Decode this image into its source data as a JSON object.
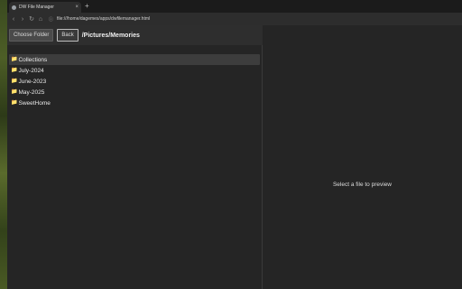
{
  "browser": {
    "tab_title": "DW File Manager",
    "tab_close": "×",
    "new_tab": "+",
    "url": "file:///home/dagemes/apps/dwfilemanager.html",
    "nav": {
      "back": "‹",
      "forward": "›",
      "reload": "↻",
      "home": "⌂",
      "info": "ⓘ"
    }
  },
  "toolbar": {
    "choose_folder_label": "Choose Folder",
    "back_label": "Back",
    "current_path": "/Pictures/Memories"
  },
  "files": [
    {
      "name": "Collections",
      "icon": "folder-icon",
      "selected": true
    },
    {
      "name": "July-2024",
      "icon": "folder-icon",
      "selected": false
    },
    {
      "name": "June-2023",
      "icon": "folder-icon",
      "selected": false
    },
    {
      "name": "May-2025",
      "icon": "folder-icon",
      "selected": false
    },
    {
      "name": "SweetHome",
      "icon": "folder-icon",
      "selected": false
    }
  ],
  "preview": {
    "empty_message": "Select a file to preview"
  },
  "colors": {
    "background": "#242424",
    "folder": "#f2c14e",
    "selected_row": "#3d3d3d"
  }
}
